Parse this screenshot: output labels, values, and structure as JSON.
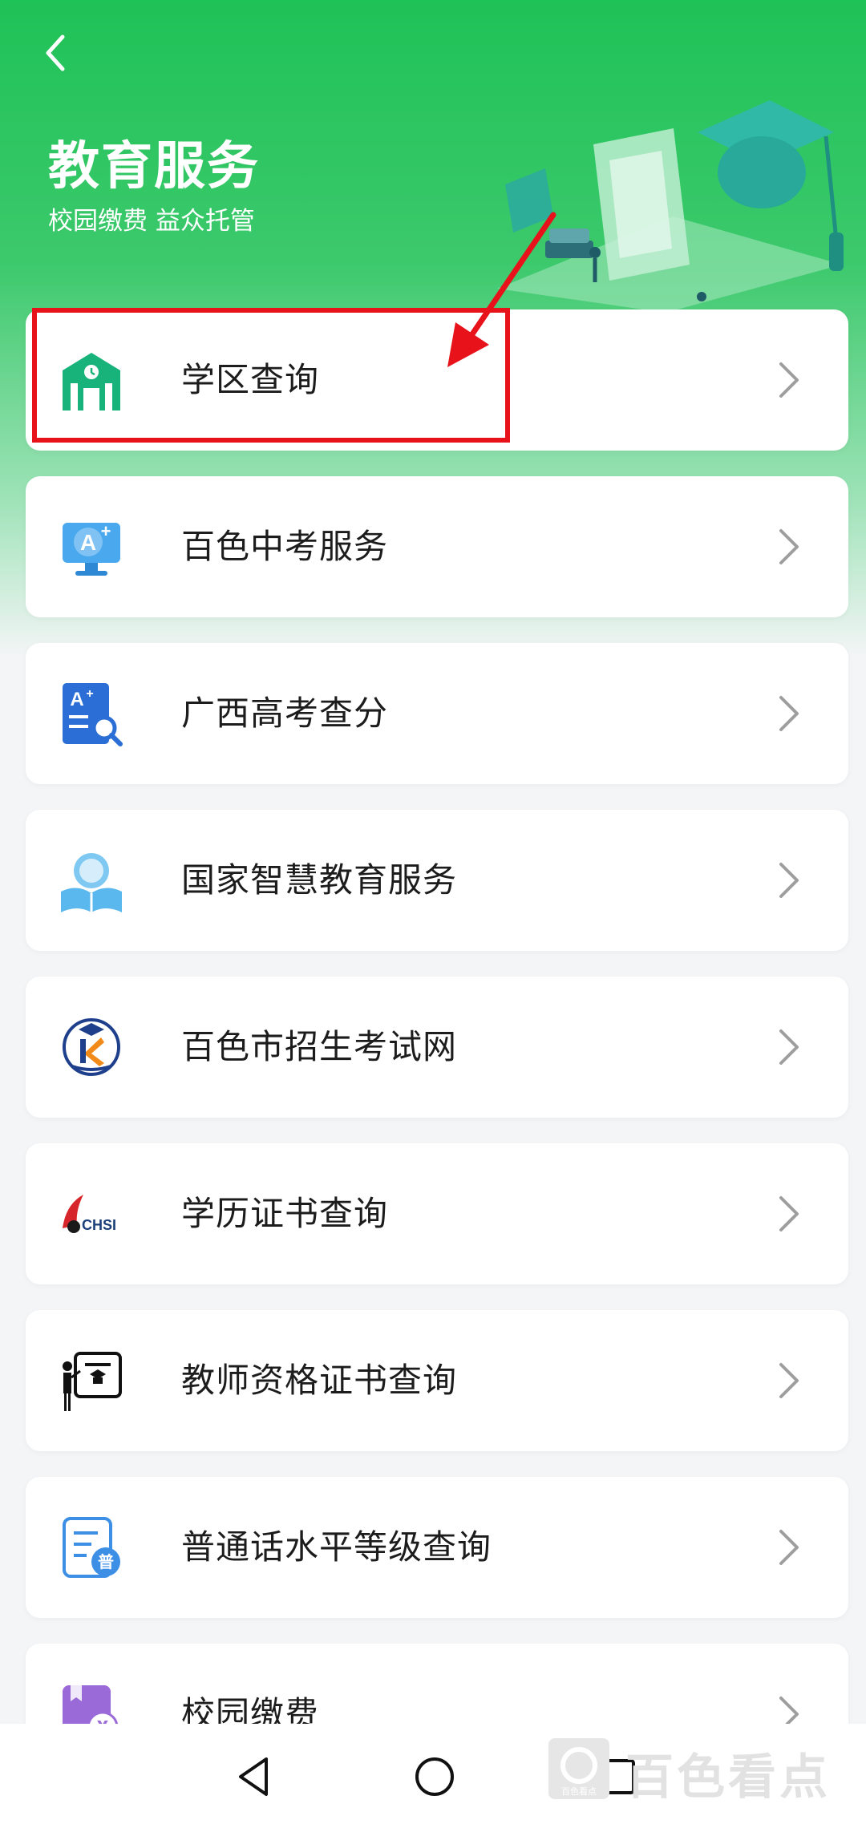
{
  "header": {
    "title": "教育服务",
    "subtitle": "校园缴费 益众托管"
  },
  "items": [
    {
      "label": "学区查询",
      "icon": "school-building-icon"
    },
    {
      "label": "百色中考服务",
      "icon": "monitor-a-plus-icon"
    },
    {
      "label": "广西高考查分",
      "icon": "score-search-icon"
    },
    {
      "label": "国家智慧教育服务",
      "icon": "student-reading-icon"
    },
    {
      "label": "百色市招生考试网",
      "icon": "exam-logo-icon"
    },
    {
      "label": "学历证书查询",
      "icon": "chsi-logo-icon"
    },
    {
      "label": "教师资格证书查询",
      "icon": "teacher-board-icon"
    },
    {
      "label": "普通话水平等级查询",
      "icon": "putonghua-doc-icon"
    },
    {
      "label": "校园缴费",
      "icon": "payment-icon"
    }
  ],
  "chsi_text": "CHSI",
  "pu_char": "普",
  "watermark": {
    "text": "百色看点",
    "small": "百色看点"
  },
  "colors": {
    "brand_green": "#1fc257",
    "annotation_red": "#e8121b"
  }
}
